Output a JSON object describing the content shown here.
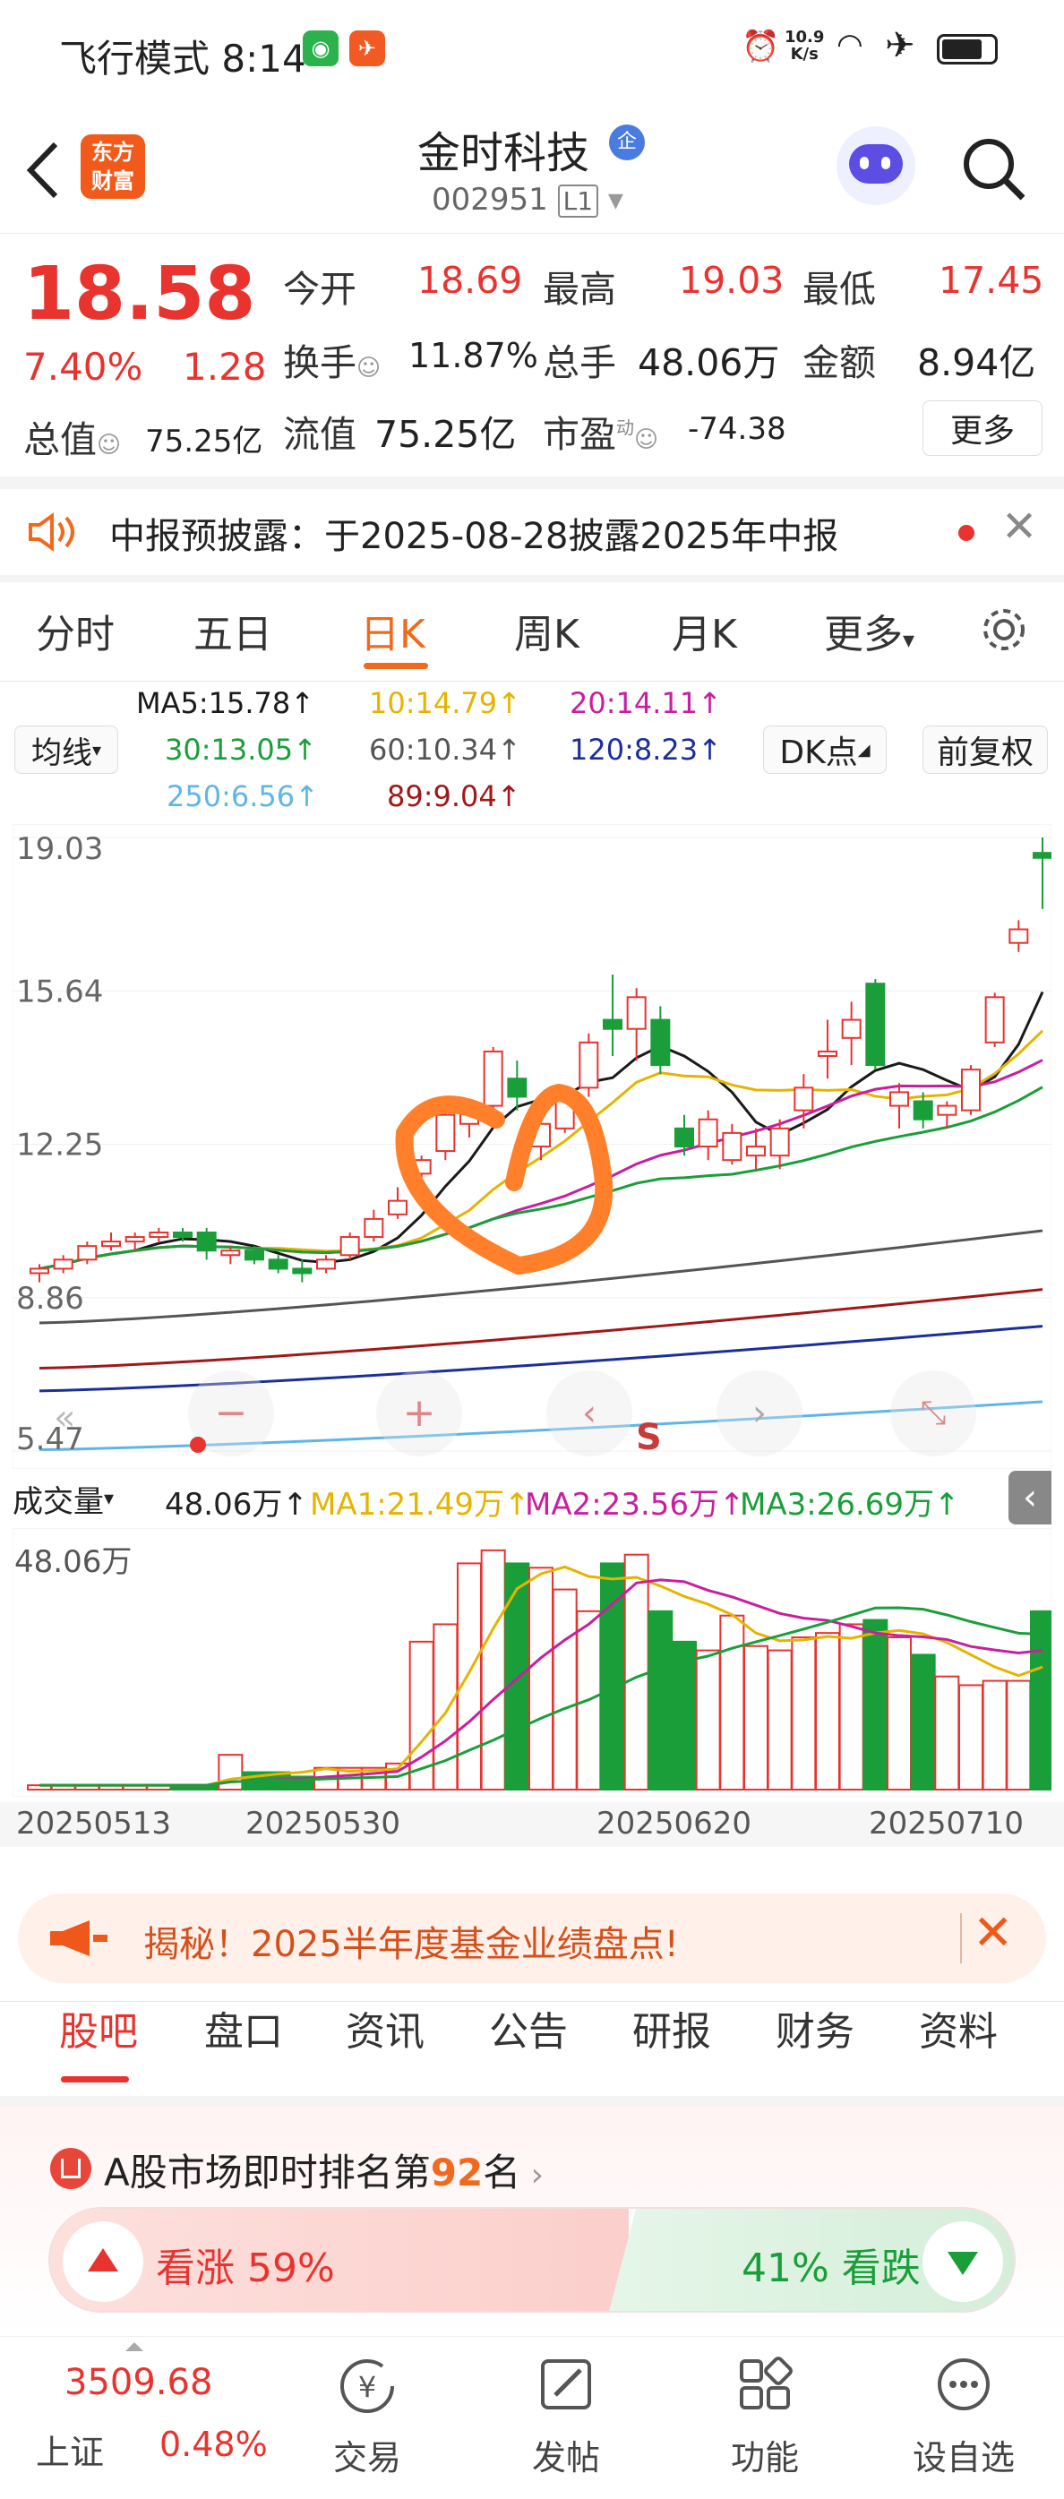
{
  "status_bar": {
    "mode": "飞行模式",
    "time": "8:14",
    "net_speed_value": "10.9",
    "net_speed_unit": "K/s"
  },
  "header": {
    "stock_name": "金时科技",
    "badge": "企",
    "stock_code": "002951",
    "level": "L1",
    "logo_line1": "东方",
    "logo_line2": "财富"
  },
  "quote": {
    "price": "18.58",
    "change_pct": "7.40%",
    "change_amt": "1.28",
    "open_label": "今开",
    "open": "18.69",
    "high_label": "最高",
    "high": "19.03",
    "low_label": "最低",
    "low": "17.45",
    "turnover_label": "换手",
    "turnover": "11.87%",
    "volume_label": "总手",
    "volume": "48.06万",
    "amount_label": "金额",
    "amount": "8.94亿",
    "mktcap_label": "总值",
    "mktcap": "75.25亿",
    "float_label": "流值",
    "float_cap": "75.25亿",
    "pe_label": "市盈",
    "pe_sup": "动",
    "pe": "-74.38",
    "more_button": "更多"
  },
  "notice": {
    "text": "中报预披露：于2025-08-28披露2025年中报"
  },
  "chart_tabs": [
    "分时",
    "五日",
    "日K",
    "周K",
    "月K",
    "更多"
  ],
  "active_tab": "日K",
  "ma_panel": {
    "selector": "均线",
    "ma5": "MA5:15.78↑",
    "ma10": "10:14.79↑",
    "ma20": "20:14.11↑",
    "ma30": "30:13.05↑",
    "ma60": "60:10.34↑",
    "ma120": "120:8.23↑",
    "ma250": "250:6.56↑",
    "ma89": "89:9.04↑",
    "dk_button": "DK点",
    "fq_button": "前复权"
  },
  "colors": {
    "up": "#e8332f",
    "down": "#1a9e3a",
    "ma5": "#1a1a1a",
    "ma10": "#e5b400",
    "ma20": "#c71fa0",
    "ma30": "#1a9e3a",
    "ma60": "#555555",
    "ma89": "#a01818",
    "ma120": "#1b2f9a",
    "ma250": "#5fb6e6",
    "annotation": "#ff7f2a"
  },
  "chart_data": {
    "type": "candlestick",
    "yticks": [
      "19.03",
      "15.64",
      "12.25",
      "8.86",
      "5.47"
    ],
    "xticks": [
      "20250513",
      "20250530",
      "20250620",
      "20250710"
    ],
    "candles": [
      {
        "o": 9.4,
        "h": 9.6,
        "l": 9.2,
        "c": 9.5
      },
      {
        "o": 9.5,
        "h": 9.8,
        "l": 9.4,
        "c": 9.7
      },
      {
        "o": 9.7,
        "h": 10.1,
        "l": 9.6,
        "c": 10.0
      },
      {
        "o": 10.0,
        "h": 10.3,
        "l": 9.9,
        "c": 10.1
      },
      {
        "o": 10.1,
        "h": 10.3,
        "l": 9.9,
        "c": 10.2
      },
      {
        "o": 10.2,
        "h": 10.4,
        "l": 10.1,
        "c": 10.3
      },
      {
        "o": 10.3,
        "h": 10.4,
        "l": 10.1,
        "c": 10.2
      },
      {
        "o": 10.3,
        "h": 10.4,
        "l": 9.7,
        "c": 9.9
      },
      {
        "o": 9.8,
        "h": 10.0,
        "l": 9.6,
        "c": 9.9
      },
      {
        "o": 9.9,
        "h": 10.0,
        "l": 9.6,
        "c": 9.7
      },
      {
        "o": 9.7,
        "h": 9.8,
        "l": 9.4,
        "c": 9.5
      },
      {
        "o": 9.5,
        "h": 9.7,
        "l": 9.2,
        "c": 9.4
      },
      {
        "o": 9.5,
        "h": 9.8,
        "l": 9.4,
        "c": 9.7
      },
      {
        "o": 9.8,
        "h": 10.3,
        "l": 9.7,
        "c": 10.2
      },
      {
        "o": 10.2,
        "h": 10.8,
        "l": 10.1,
        "c": 10.6
      },
      {
        "o": 10.7,
        "h": 11.3,
        "l": 10.6,
        "c": 11.0
      },
      {
        "o": 11.6,
        "h": 12.0,
        "l": 11.3,
        "c": 11.9
      },
      {
        "o": 12.1,
        "h": 13.1,
        "l": 11.9,
        "c": 12.9
      },
      {
        "o": 12.7,
        "h": 13.2,
        "l": 12.4,
        "c": 13.0
      },
      {
        "o": 13.1,
        "h": 14.4,
        "l": 13.0,
        "c": 14.3
      },
      {
        "o": 13.7,
        "h": 14.1,
        "l": 13.0,
        "c": 13.3
      },
      {
        "o": 12.2,
        "h": 12.9,
        "l": 11.9,
        "c": 12.7
      },
      {
        "o": 12.6,
        "h": 13.4,
        "l": 12.5,
        "c": 13.3
      },
      {
        "o": 13.5,
        "h": 14.7,
        "l": 13.3,
        "c": 14.5
      },
      {
        "o": 15.0,
        "h": 16.0,
        "l": 14.2,
        "c": 14.8
      },
      {
        "o": 14.8,
        "h": 15.7,
        "l": 14.1,
        "c": 15.5
      },
      {
        "o": 15.0,
        "h": 15.3,
        "l": 13.8,
        "c": 14.0
      },
      {
        "o": 12.6,
        "h": 12.9,
        "l": 12.0,
        "c": 12.2
      },
      {
        "o": 12.2,
        "h": 13.0,
        "l": 11.9,
        "c": 12.8
      },
      {
        "o": 11.9,
        "h": 12.7,
        "l": 11.8,
        "c": 12.5
      },
      {
        "o": 12.0,
        "h": 12.6,
        "l": 11.7,
        "c": 12.2
      },
      {
        "o": 12.0,
        "h": 12.8,
        "l": 11.7,
        "c": 12.6
      },
      {
        "o": 13.0,
        "h": 13.8,
        "l": 12.6,
        "c": 13.5
      },
      {
        "o": 14.2,
        "h": 15.0,
        "l": 13.7,
        "c": 14.3
      },
      {
        "o": 14.6,
        "h": 15.4,
        "l": 14.0,
        "c": 15.0
      },
      {
        "o": 15.8,
        "h": 15.9,
        "l": 13.9,
        "c": 14.0
      },
      {
        "o": 13.1,
        "h": 13.6,
        "l": 12.6,
        "c": 13.4
      },
      {
        "o": 13.2,
        "h": 13.4,
        "l": 12.6,
        "c": 12.8
      },
      {
        "o": 12.9,
        "h": 13.2,
        "l": 12.6,
        "c": 13.1
      },
      {
        "o": 13.0,
        "h": 14.0,
        "l": 12.9,
        "c": 13.9
      },
      {
        "o": 14.5,
        "h": 15.6,
        "l": 14.4,
        "c": 15.5
      },
      {
        "o": 16.7,
        "h": 17.2,
        "l": 16.5,
        "c": 17.0
      },
      {
        "o": 18.69,
        "h": 19.03,
        "l": 17.45,
        "c": 18.58
      }
    ],
    "volume_label": "成交量",
    "volume_value": "48.06万↑",
    "vol_ma1": "MA1:21.49万↑",
    "vol_ma2": "MA2:23.56万↑",
    "vol_ma3": "MA3:26.69万↑",
    "vol_max_label": "48.06万",
    "volumes": [
      1,
      1,
      1,
      1,
      1,
      1,
      1,
      1,
      8,
      4,
      4,
      3,
      5,
      5,
      5,
      6,
      34,
      38,
      52,
      55,
      52,
      51,
      46,
      41,
      52,
      54,
      41,
      34,
      32,
      40,
      33,
      32,
      35,
      36,
      38,
      39,
      35,
      31,
      26,
      24,
      25,
      25,
      41
    ]
  },
  "promo": {
    "text": "揭秘！2025半年度基金业绩盘点!"
  },
  "sub_tabs": [
    "股吧",
    "盘口",
    "资讯",
    "公告",
    "研报",
    "财务",
    "资料"
  ],
  "rank": {
    "prefix": "A股市场即时排名第",
    "rank": "92",
    "suffix": "名"
  },
  "sentiment": {
    "up": "看涨 59%",
    "down": "41% 看跌",
    "up_pct": 59
  },
  "index": {
    "value": "3509.68",
    "name": "上证",
    "change": "0.48%"
  },
  "bottom_nav": [
    "交易",
    "发帖",
    "功能",
    "设自选"
  ]
}
